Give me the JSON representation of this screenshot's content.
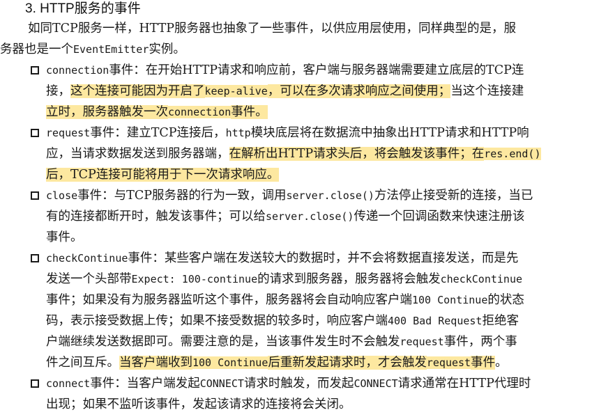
{
  "section": {
    "heading": "3. HTTP服务的事件"
  },
  "intro": {
    "line1": "如同TCP服务一样，HTTP服务器也抽象了一些事件，以供应用层使用，同样典型的是，服",
    "line2a": "务器也是一个",
    "line2_code": "EventEmitter",
    "line2b": "实例。"
  },
  "items": [
    {
      "lines": [
        [
          {
            "t": "connection",
            "c": 1
          },
          {
            "t": "事件：在开始HTTP请求和响应前，客户端与服务器端需要建立底层的TCP连"
          }
        ],
        [
          {
            "t": "接，"
          },
          {
            "t": "这个连接可能因为开启了",
            "h": 1
          },
          {
            "t": "keep-alive",
            "c": 1,
            "h": 1
          },
          {
            "t": "，可以在多次请求响应之间使用；",
            "h": 1
          },
          {
            "t": "当这个连接建"
          }
        ],
        [
          {
            "t": "立时，服务器触发一次",
            "h": 1
          },
          {
            "t": "connection",
            "c": 1,
            "h": 1
          },
          {
            "t": "事件。",
            "h": 1
          }
        ]
      ]
    },
    {
      "lines": [
        [
          {
            "t": "request",
            "c": 1
          },
          {
            "t": "事件：建立TCP连接后，"
          },
          {
            "t": "http",
            "c": 1
          },
          {
            "t": "模块底层将在数据流中抽象出HTTP请求和HTTP响"
          }
        ],
        [
          {
            "t": "应，当请求数据发送到服务器端，"
          },
          {
            "t": "在解析出HTTP请求头后，将会触发该事件；在",
            "h": 1
          },
          {
            "t": "res.end()",
            "c": 1,
            "h": 1
          }
        ],
        [
          {
            "t": "后，TCP连接可能将用于下一次请求响应。",
            "h": 1
          }
        ]
      ]
    },
    {
      "lines": [
        [
          {
            "t": "close",
            "c": 1
          },
          {
            "t": "事件：与TCP服务器的行为一致，调用"
          },
          {
            "t": "server.close()",
            "c": 1
          },
          {
            "t": "方法停止接受新的连接，当已"
          }
        ],
        [
          {
            "t": "有的连接都断开时，触发该事件；可以给"
          },
          {
            "t": "server.close()",
            "c": 1
          },
          {
            "t": "传递一个回调函数来快速注册该"
          }
        ],
        [
          {
            "t": "事件。"
          }
        ]
      ]
    },
    {
      "lines": [
        [
          {
            "t": "checkContinue",
            "c": 1
          },
          {
            "t": "事件：某些客户端在发送较大的数据时，并不会将数据直接发送，而是先"
          }
        ],
        [
          {
            "t": "发送一个头部带"
          },
          {
            "t": "Expect: 100-continue",
            "c": 1
          },
          {
            "t": "的请求到服务器，服务器将会触发"
          },
          {
            "t": "checkContinue",
            "c": 1
          }
        ],
        [
          {
            "t": "事件；如果没有为服务器监听这个事件，服务器将会自动响应客户端"
          },
          {
            "t": "100 Continue",
            "c": 1
          },
          {
            "t": "的状态"
          }
        ],
        [
          {
            "t": "码，表示接受数据上传；如果不接受数据的较多时，响应客户端"
          },
          {
            "t": "400 Bad Request",
            "c": 1
          },
          {
            "t": "拒绝客"
          }
        ],
        [
          {
            "t": "户端继续发送数据即可。需要注意的是，当该事件发生时不会触发"
          },
          {
            "t": "request",
            "c": 1
          },
          {
            "t": "事件，两个事"
          }
        ],
        [
          {
            "t": "件之间互斥。"
          },
          {
            "t": "当客户端收到",
            "h": 1
          },
          {
            "t": "100 Continue",
            "c": 1,
            "h": 1
          },
          {
            "t": "后重新发起请求时，才会触发",
            "h": 1
          },
          {
            "t": "request",
            "c": 1,
            "h": 1
          },
          {
            "t": "事件",
            "h": 1
          },
          {
            "t": "。"
          }
        ]
      ]
    },
    {
      "lines": [
        [
          {
            "t": "connect",
            "c": 1
          },
          {
            "t": "事件：当客户端发起"
          },
          {
            "t": "CONNECT",
            "c": 1
          },
          {
            "t": "请求时触发，而发起"
          },
          {
            "t": "CONNECT",
            "c": 1
          },
          {
            "t": "请求通常在HTTP代理时"
          }
        ],
        [
          {
            "t": "出现；如果不监听该事件，发起该请求的连接将会关闭。"
          }
        ]
      ]
    }
  ]
}
